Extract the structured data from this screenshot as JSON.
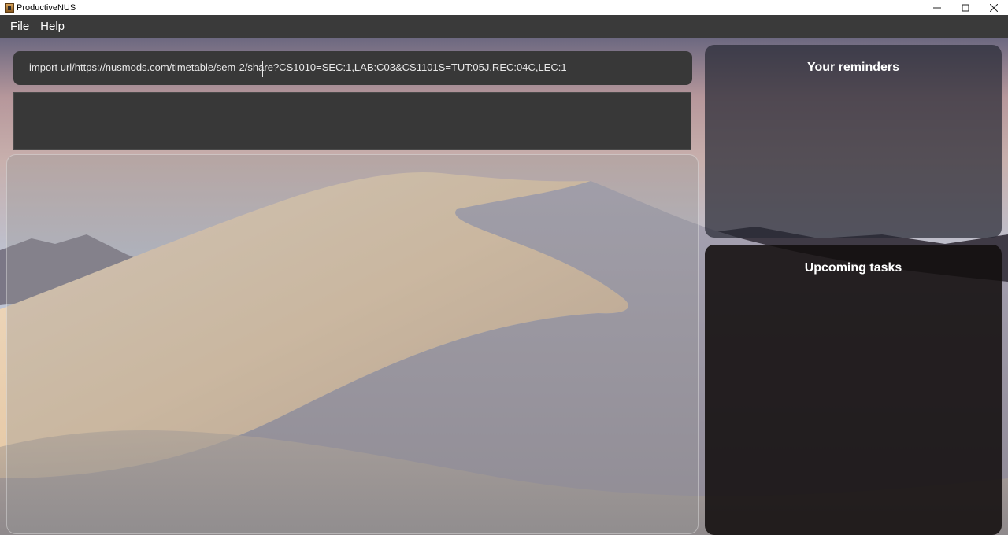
{
  "window": {
    "title": "ProductiveNUS",
    "controls": [
      "minimize-icon",
      "maximize-icon",
      "close-icon"
    ]
  },
  "menu": {
    "items": [
      {
        "label": "File"
      },
      {
        "label": "Help"
      }
    ]
  },
  "command": {
    "value": "import url/https://nusmods.com/timetable/sem-2/share?CS1010=SEC:1,LAB:C03&CS1101S=TUT:05J,REC:04C,LEC:1"
  },
  "result": {
    "text": ""
  },
  "reminders": {
    "title": "Your reminders"
  },
  "tasks": {
    "title": "Upcoming tasks"
  },
  "colors": {
    "menubar": "#3a3a3a",
    "command_box": "#383838",
    "panel_text": "#ffffff"
  }
}
